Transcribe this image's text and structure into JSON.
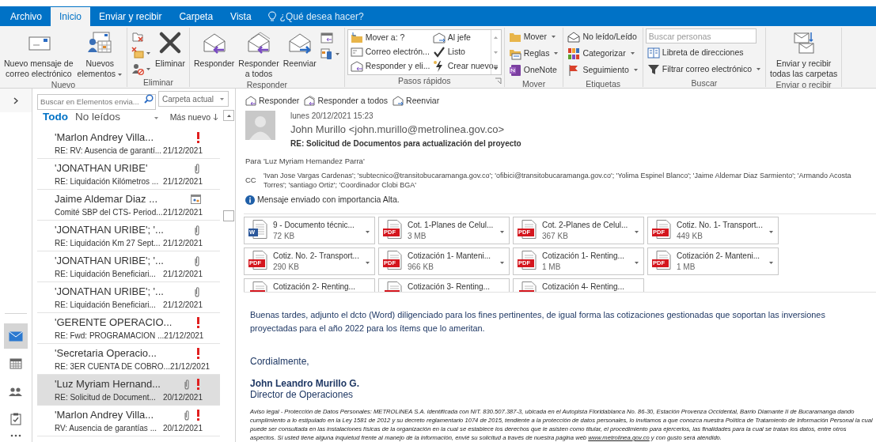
{
  "tabs": [
    {
      "label": "Archivo",
      "selected": false
    },
    {
      "label": "Inicio",
      "selected": true
    },
    {
      "label": "Enviar y recibir",
      "selected": false
    },
    {
      "label": "Carpeta",
      "selected": false
    },
    {
      "label": "Vista",
      "selected": false
    }
  ],
  "tell_me": "¿Qué desea hacer?",
  "ribbon": [
    {
      "label": "Nuevo",
      "items": [
        {
          "kind": "large",
          "lines": [
            "Nuevo mensaje de",
            "correo electrónico"
          ],
          "dropdown": false
        },
        {
          "kind": "large",
          "lines": [
            "Nuevos",
            "elementos"
          ],
          "dropdown": true
        }
      ]
    },
    {
      "label": "Eliminar",
      "items": [
        {
          "kind": "large",
          "lines": [
            "Eliminar"
          ],
          "dropdown": false
        }
      ]
    },
    {
      "label": "Responder",
      "items": [
        {
          "kind": "large",
          "lines": [
            "Responder"
          ],
          "dropdown": false
        },
        {
          "kind": "large",
          "lines": [
            "Responder",
            "a todos"
          ],
          "dropdown": false
        },
        {
          "kind": "large",
          "lines": [
            "Reenviar"
          ],
          "dropdown": false
        }
      ]
    },
    {
      "label": "Pasos rápidos",
      "items": [
        {
          "kind": "quickstep",
          "label": "Mover a: ?"
        },
        {
          "kind": "quickstep",
          "label": "Al jefe"
        },
        {
          "kind": "quickstep",
          "label": "Correo electrón..."
        },
        {
          "kind": "quickstep",
          "label": "Listo"
        },
        {
          "kind": "quickstep",
          "label": "Responder y eli..."
        },
        {
          "kind": "quickstep",
          "label": "Crear nuevo"
        }
      ]
    },
    {
      "label": "Mover",
      "items": [
        {
          "kind": "small",
          "label": "Mover",
          "dropdown": true
        },
        {
          "kind": "small",
          "label": "Reglas",
          "dropdown": true
        },
        {
          "kind": "small",
          "label": "OneNote",
          "dropdown": false
        }
      ]
    },
    {
      "label": "Etiquetas",
      "items": [
        {
          "kind": "small",
          "label": "No leído/Leído",
          "dropdown": false
        },
        {
          "kind": "small",
          "label": "Categorizar",
          "dropdown": true
        },
        {
          "kind": "small",
          "label": "Seguimiento",
          "dropdown": true
        }
      ]
    },
    {
      "label": "Buscar",
      "items": [
        {
          "kind": "search",
          "placeholder": "Buscar personas"
        },
        {
          "kind": "small",
          "label": "Libreta de direcciones",
          "dropdown": false
        },
        {
          "kind": "small",
          "label": "Filtrar correo electrónico",
          "dropdown": true
        }
      ]
    },
    {
      "label": "Enviar o recibir",
      "items": [
        {
          "kind": "large",
          "lines": [
            "Enviar y recibir",
            "todas las carpetas"
          ],
          "dropdown": false
        }
      ]
    }
  ],
  "nav_items": [
    {
      "selected": true
    },
    {
      "selected": false
    },
    {
      "selected": false
    },
    {
      "selected": false
    }
  ],
  "mail_search": {
    "placeholder": "Buscar en Elementos envia...",
    "scope": "Carpeta actual"
  },
  "filters": [
    {
      "label": "Todo",
      "selected": true
    },
    {
      "label": "No leídos",
      "selected": false
    }
  ],
  "sort": "Más nuevo",
  "messages": [
    {
      "sender": "'Marlon Andrey Villa...",
      "subject": "RE: RV: Ausencia de garantí...",
      "date": "21/12/2021",
      "attachment": false,
      "important": true,
      "meeting": false,
      "selected": false
    },
    {
      "sender": "'JONATHAN URIBE'",
      "subject": "RE: Liquidación Kilómetros ...",
      "date": "21/12/2021",
      "attachment": true,
      "important": false,
      "meeting": false,
      "selected": false
    },
    {
      "sender": "Jaime Aldemar Diaz ...",
      "subject": "Comité  SBP del CTS- Period...",
      "date": "21/12/2021",
      "attachment": false,
      "important": false,
      "meeting": true,
      "selected": false
    },
    {
      "sender": "'JONATHAN URIBE'; '...",
      "subject": "RE: Liquidación Km 27 Sept...",
      "date": "21/12/2021",
      "attachment": true,
      "important": false,
      "meeting": false,
      "selected": false
    },
    {
      "sender": "'JONATHAN URIBE'; '...",
      "subject": "RE: Liquidación Beneficiari...",
      "date": "21/12/2021",
      "attachment": true,
      "important": false,
      "meeting": false,
      "selected": false
    },
    {
      "sender": "'JONATHAN URIBE'; '...",
      "subject": "RE: Liquidación Beneficiari...",
      "date": "21/12/2021",
      "attachment": true,
      "important": false,
      "meeting": false,
      "selected": false
    },
    {
      "sender": "'GERENTE OPERACIO...",
      "subject": "RE: Fwd: PROGRAMACION ...",
      "date": "21/12/2021",
      "attachment": false,
      "important": true,
      "meeting": false,
      "selected": false
    },
    {
      "sender": "'Secretaria Operacio...",
      "subject": "RE: 3ER CUENTA DE COBRO...",
      "date": "21/12/2021",
      "attachment": false,
      "important": true,
      "meeting": false,
      "selected": false
    },
    {
      "sender": "'Luz Myriam Hernand...",
      "subject": "RE: Solicitud de Document...",
      "date": "20/12/2021",
      "attachment": true,
      "important": true,
      "meeting": false,
      "selected": true
    },
    {
      "sender": "'Marlon Andrey Villa...",
      "subject": "RV: Ausencia de garantías ...",
      "date": "20/12/2021",
      "attachment": true,
      "important": true,
      "meeting": false,
      "selected": false
    }
  ],
  "actions": [
    "Responder",
    "Responder a todos",
    "Reenviar"
  ],
  "message": {
    "sent": "lunes 20/12/2021 15:23",
    "from": "John Murillo <john.murillo@metrolinea.gov.co>",
    "subject": "RE: Solicitud de Documentos para actualización del proyecto",
    "to_label": "Para",
    "to": "'Luz Myriam Hernandez Parra'",
    "cc_label": "CC",
    "cc": "'Ivan Jose Vargas Cardenas'; 'subtecnico@transitobucaramanga.gov.co'; 'ofibici@transitobucaramanga.gov.co'; 'Yolima Espinel Blanco'; 'Jaime Aldemar Diaz Sarmiento'; 'Armando Acosta Torres'; 'santiago Ortiz'; 'Coordinador Clobi BGA'",
    "info": "Mensaje enviado con importancia Alta.",
    "attachments": [
      {
        "name": "9 - Documento técnic...",
        "size": "72 KB",
        "kind": "word",
        "icon_label": "W"
      },
      {
        "name": "Cot. 1-Planes de Celul...",
        "size": "3 MB",
        "kind": "pdf",
        "icon_label": "PDF"
      },
      {
        "name": "Cot. 2-Planes de Celul...",
        "size": "367 KB",
        "kind": "pdf",
        "icon_label": "PDF"
      },
      {
        "name": "Cotiz. No. 1- Transport...",
        "size": "449 KB",
        "kind": "pdf",
        "icon_label": "PDF"
      },
      {
        "name": "Cotiz. No. 2- Transport...",
        "size": "290 KB",
        "kind": "pdf",
        "icon_label": "PDF"
      },
      {
        "name": "Cotización 1- Manteni...",
        "size": "966 KB",
        "kind": "pdf",
        "icon_label": "PDF"
      },
      {
        "name": "Cotización 1- Renting...",
        "size": "1 MB",
        "kind": "pdf",
        "icon_label": "PDF"
      },
      {
        "name": "Cotización 2- Manteni...",
        "size": "1 MB",
        "kind": "pdf",
        "icon_label": "PDF"
      },
      {
        "name": "Cotización 2- Renting...",
        "kind": "pdf"
      },
      {
        "name": "Cotización 3- Renting...",
        "kind": "pdf"
      },
      {
        "name": "Cotización 4- Renting...",
        "kind": "pdf"
      }
    ],
    "body": "Buenas tardes, adjunto el dcto (Word) diligenciado para los fines pertinentes, de igual forma las cotizaciones gestionadas que soportan las inversiones proyectadas para el año 2022 para los ítems que lo ameritan.",
    "closing": "Cordialmente,",
    "signature_name": "John Leandro Murillo G.",
    "signature_title": "Director de Operaciones",
    "legal_before": "Aviso legal - Protección de Datos Personales: METROLINEA S.A. identificada con NIT. 830.507.387-3, ubicada en el Autopista Floridablanca No. 86-30, Estación Provenza Occidental, Barrio Diamante II de Bucaramanga dando cumplimiento a lo estipulado en la Ley 1581 de 2012 y su decreto reglamentario 1074 de 2015, tendiente a la protección de datos personales, lo invitamos a que conozca nuestra Política de Tratamiento de Información Personal la cual puede ser consultada en las instalaciones físicas de la organización en la cual se establece los derechos que le asisten como titular, el procedimiento para ejercerlos, las finalidades para la cual se tratan los datos, entre otros aspectos. Si usted tiene alguna inquietud frente al manejo de la información, envié su solicitud a través de nuestra página web",
    "legal_link": "www.metrolinea.gov.co",
    "legal_after": "y con gusto será atendido."
  }
}
